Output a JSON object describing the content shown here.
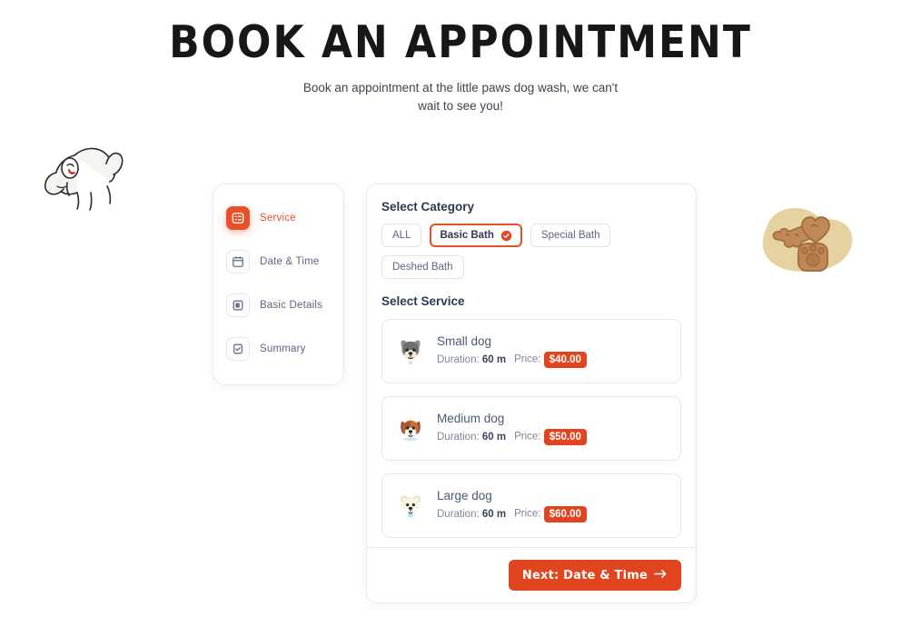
{
  "header": {
    "title": "BOOK AN APPOINTMENT",
    "subtitle": "Book an appointment at the little paws dog wash, we can't wait to see you!"
  },
  "decorations": {
    "left_illustration": "puppy-line-drawing",
    "right_illustration": "dog-treats-bone-heart-paw"
  },
  "stepper": {
    "items": [
      {
        "label": "Service",
        "icon": "list-icon",
        "active": true
      },
      {
        "label": "Date & Time",
        "icon": "calendar-icon",
        "active": false
      },
      {
        "label": "Basic Details",
        "icon": "note-icon",
        "active": false
      },
      {
        "label": "Summary",
        "icon": "clipboard-check-icon",
        "active": false
      }
    ]
  },
  "main": {
    "category_title": "Select Category",
    "categories": [
      {
        "label": "ALL",
        "selected": false
      },
      {
        "label": "Basic Bath",
        "selected": true
      },
      {
        "label": "Special Bath",
        "selected": false
      },
      {
        "label": "Deshed Bath",
        "selected": false
      }
    ],
    "service_title": "Select Service",
    "duration_label": "Duration:",
    "price_label": "Price:",
    "services": [
      {
        "name": "Small dog",
        "duration": "60 m",
        "price": "$40.00",
        "avatar": "schnauzer-face-icon"
      },
      {
        "name": "Medium dog",
        "duration": "60 m",
        "price": "$50.00",
        "avatar": "beagle-face-icon"
      },
      {
        "name": "Large dog",
        "duration": "60 m",
        "price": "$60.00",
        "avatar": "fluffy-white-dog-face-icon"
      }
    ],
    "next_button": "Next: Date & Time"
  },
  "colors": {
    "accent": "#e8502a",
    "price_badge": "#e0451f",
    "text_dark": "#2f3a50",
    "text_muted": "#7b8699",
    "border": "#e6eaf2",
    "treat_blob": "#e8d49a",
    "treat_brown": "#b57c52"
  }
}
